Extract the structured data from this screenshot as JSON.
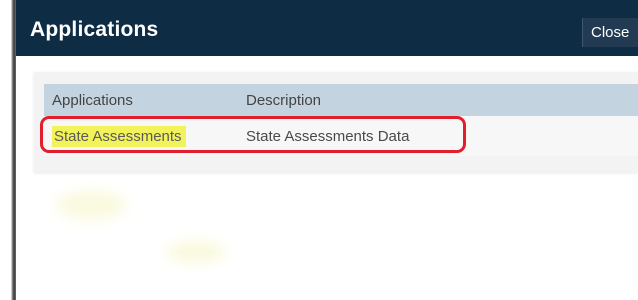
{
  "dialog": {
    "title": "Applications",
    "close_label": "Close"
  },
  "table": {
    "columns": [
      "Applications",
      "Description"
    ],
    "rows": [
      {
        "application": "State Assessments",
        "description": "State Assessments Data",
        "highlighted": true
      }
    ]
  },
  "colors": {
    "titlebar": "#0f2c45",
    "header_row": "#c3d3df",
    "highlight": "#f2f25a",
    "annotation_box": "#e21e2d"
  }
}
